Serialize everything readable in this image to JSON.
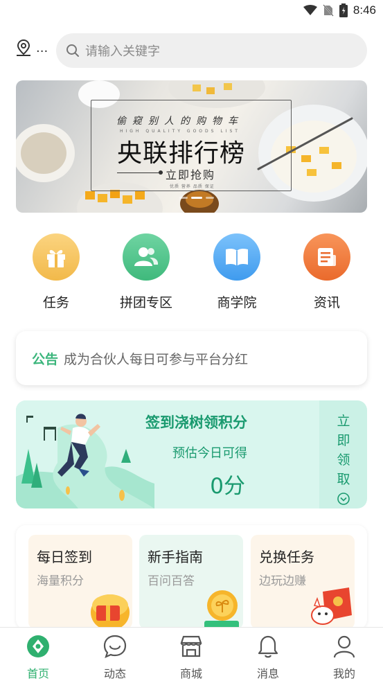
{
  "status_bar": {
    "time": "8:46"
  },
  "header": {
    "location_text": "...",
    "search_placeholder": "请输入关键字"
  },
  "banner": {
    "subtitle": "偷窥别人的购物车",
    "tiny_text": "HIGH QUALITY GOODS LIST",
    "title": "央联排行榜",
    "cta": "立即抢购",
    "micro_text": "优质 营养 品质 保证",
    "indicator_count": 3,
    "active_index": 1
  },
  "categories": [
    {
      "label": "任务",
      "icon": "gift-icon",
      "color": "#f6c259"
    },
    {
      "label": "拼团专区",
      "icon": "group-users-icon",
      "color": "#4cc48b"
    },
    {
      "label": "商学院",
      "icon": "book-icon",
      "color": "#4fa8f2"
    },
    {
      "label": "资讯",
      "icon": "news-icon",
      "color": "#f07a3c"
    }
  ],
  "notice": {
    "tag": "公告",
    "text": "成为合伙人每日可参与平台分红"
  },
  "signin": {
    "title": "签到浇树领积分",
    "estimate_label": "预估今日可得",
    "points": "0分",
    "claim_chars": [
      "立",
      "即",
      "领",
      "取"
    ]
  },
  "tasks": [
    {
      "title": "每日签到",
      "subtitle": "海量积分",
      "bg": "#fdf5ea",
      "icon": "gift-egg-icon"
    },
    {
      "title": "新手指南",
      "subtitle": "百问百答",
      "bg": "#eaf7f1",
      "icon": "coin-sprout-icon"
    },
    {
      "title": "兑换任务",
      "subtitle": "边玩边赚",
      "bg": "#fdf5ea",
      "icon": "red-envelope-icon"
    }
  ],
  "bottom_nav": [
    {
      "label": "首页",
      "icon": "home-compass-icon",
      "active": true
    },
    {
      "label": "动态",
      "icon": "chat-smile-icon",
      "active": false
    },
    {
      "label": "商城",
      "icon": "shop-icon",
      "active": false
    },
    {
      "label": "消息",
      "icon": "bell-icon",
      "active": false
    },
    {
      "label": "我的",
      "icon": "user-icon",
      "active": false
    }
  ],
  "colors": {
    "accent": "#2fb06f",
    "signin_text": "#1a9a6f"
  }
}
